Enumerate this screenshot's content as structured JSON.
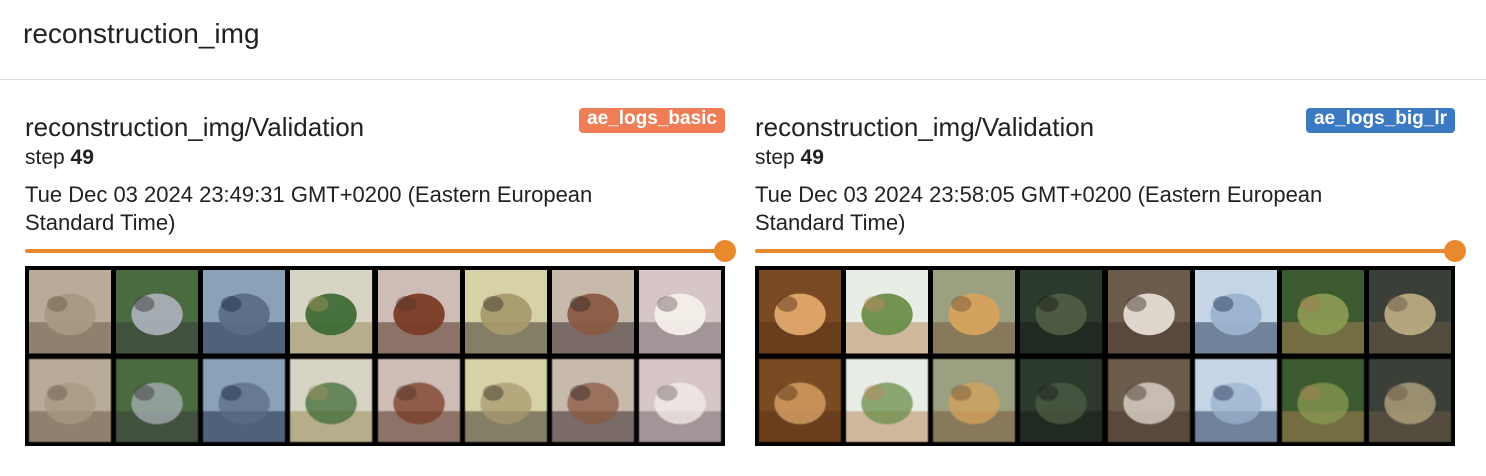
{
  "header": {
    "title": "reconstruction_img"
  },
  "cards": [
    {
      "title": "reconstruction_img/Validation",
      "run_label": "ae_logs_basic",
      "run_color": "#ef7e57",
      "step_label": "step",
      "step_value": "49",
      "timestamp": "Tue Dec 03 2024 23:49:31 GMT+0200 (Eastern European Standard Time)",
      "slider_color": "#e8892d",
      "slider_position": 1.0,
      "image_alt": "8x2 grid of CIFAR validation images (top: originals, bottom: reconstructions)"
    },
    {
      "title": "reconstruction_img/Validation",
      "run_label": "ae_logs_big_lr",
      "run_color": "#3b79c2",
      "step_label": "step",
      "step_value": "49",
      "timestamp": "Tue Dec 03 2024 23:58:05 GMT+0200 (Eastern European Standard Time)",
      "slider_color": "#e8892d",
      "slider_position": 1.0,
      "image_alt": "8x2 grid of CIFAR validation images (top: originals, bottom: reconstructions)"
    }
  ]
}
